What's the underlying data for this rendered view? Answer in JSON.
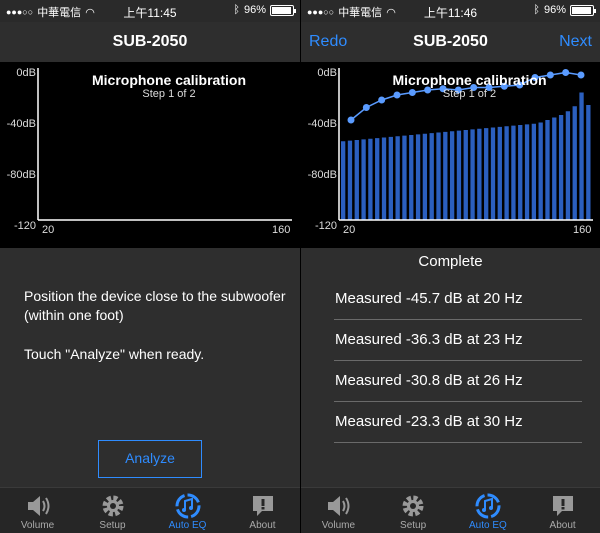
{
  "status_bar": {
    "carrier": "中華電信",
    "time_left": "上午11:45",
    "time_right": "上午11:46",
    "battery": "96%",
    "battery_fraction": 0.96
  },
  "left": {
    "nav": {
      "title": "SUB-2050"
    },
    "chart_title": "Microphone calibration",
    "chart_sub": "Step 1 of 2",
    "instruction_1": "Position the device close to the subwoofer (within one foot)",
    "instruction_2": "Touch \"Analyze\" when ready.",
    "analyze_label": "Analyze"
  },
  "right": {
    "nav": {
      "title": "SUB-2050",
      "redo": "Redo",
      "next": "Next"
    },
    "chart_title": "Microphone calibration",
    "chart_sub": "Step 1 of 2",
    "complete_label": "Complete",
    "measurements": [
      "Measured -45.7 dB at 20 Hz",
      "Measured -36.3 dB at 23 Hz",
      "Measured -30.8 dB at 26 Hz",
      "Measured -23.3 dB at 30 Hz"
    ]
  },
  "chart_axes": {
    "y_ticks": [
      "0dB",
      "-40dB",
      "-80dB",
      "-120"
    ],
    "x_ticks": [
      "20",
      "160"
    ]
  },
  "chart_data": {
    "type": "bar",
    "ylim": [
      -120,
      0
    ],
    "xlim": [
      20,
      160
    ],
    "bars": [
      -57,
      -56.5,
      -56,
      -55.5,
      -55,
      -54.5,
      -54,
      -53.5,
      -53,
      -52.5,
      -52,
      -51.5,
      -51,
      -50.5,
      -50,
      -49.5,
      -49,
      -48.5,
      -48,
      -47.5,
      -47,
      -46.5,
      -46,
      -45.5,
      -45,
      -44.5,
      -44,
      -43.5,
      -43,
      -42,
      -40,
      -38,
      -36,
      -33,
      -29,
      -18,
      -28
    ],
    "line": [
      -40,
      -30,
      -24,
      -20,
      -18,
      -16,
      -15,
      -16,
      -14,
      -14,
      -13,
      -12,
      -6,
      -4,
      -2,
      -4
    ]
  },
  "tabs": [
    {
      "label": "Volume",
      "icon": "speaker-icon"
    },
    {
      "label": "Setup",
      "icon": "gear-icon"
    },
    {
      "label": "Auto EQ",
      "icon": "sync-music-icon"
    },
    {
      "label": "About",
      "icon": "alert-bubble-icon"
    }
  ],
  "colors": {
    "accent": "#2f8cff",
    "bar": "#2b5fbf",
    "line": "#5a9bff"
  }
}
